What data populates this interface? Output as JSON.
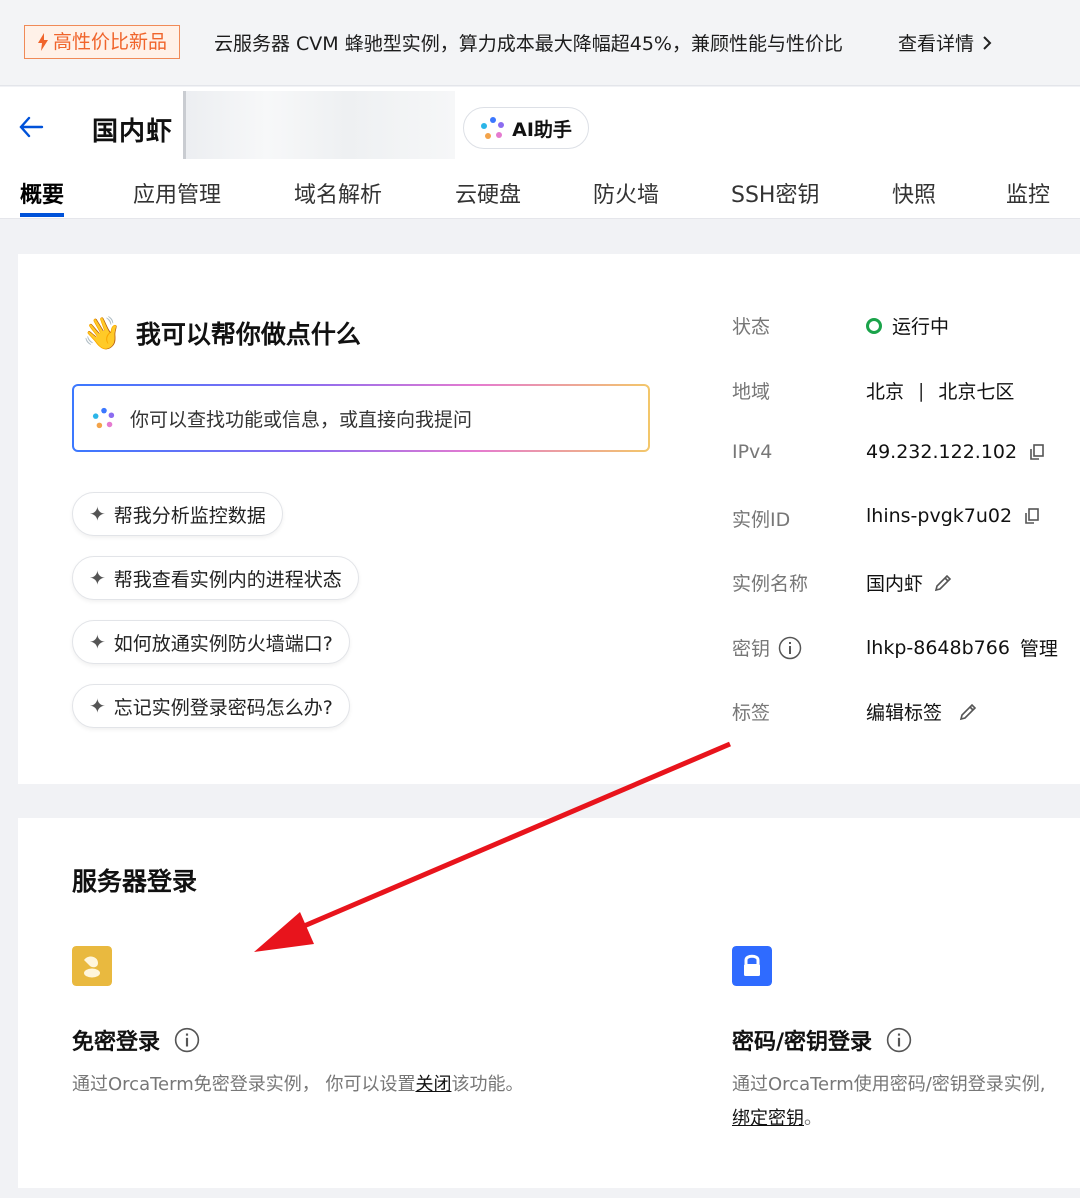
{
  "banner": {
    "tag": "高性价比新品",
    "text": "云服务器 CVM 蜂驰型实例，算力成本最大降幅超45%，兼顾性能与性价比",
    "link": "查看详情"
  },
  "header": {
    "title": "国内虾",
    "ai_button": "AI助手"
  },
  "tabs": [
    "概要",
    "应用管理",
    "域名解析",
    "云硬盘",
    "防火墙",
    "SSH密钥",
    "快照",
    "监控"
  ],
  "assistant": {
    "title": "我可以帮你做点什么",
    "placeholder": "你可以查找功能或信息，或直接向我提问",
    "suggestions": [
      "帮我分析监控数据",
      "帮我查看实例内的进程状态",
      "如何放通实例防火墙端口?",
      "忘记实例登录密码怎么办?"
    ]
  },
  "info": {
    "status_label": "状态",
    "status_value": "运行中",
    "region_label": "地域",
    "region_city": "北京",
    "region_zone": "北京七区",
    "ipv4_label": "IPv4",
    "ipv4_value": "49.232.122.102",
    "id_label": "实例ID",
    "id_value": "lhins-pvgk7u02",
    "name_label": "实例名称",
    "name_value": "国内虾",
    "key_label": "密钥",
    "key_value": "lhkp-8648b766",
    "key_manage": "管理",
    "tag_label": "标签",
    "tag_value": "编辑标签"
  },
  "login": {
    "title": "服务器登录",
    "nopw_title": "免密登录",
    "nopw_desc_prefix": "通过OrcaTerm免密登录实例，  你可以设置",
    "nopw_desc_link": "关闭",
    "nopw_desc_suffix": "该功能。",
    "pw_title": "密码/密钥登录",
    "pw_desc": "通过OrcaTerm使用密码/密钥登录实例,",
    "pw_link": "绑定密钥",
    "pw_link_suffix": "。"
  },
  "colors": {
    "accent": "#0052d9",
    "running": "#1aa34a",
    "promo": "#f0642b",
    "arrow": "#e8141c"
  }
}
